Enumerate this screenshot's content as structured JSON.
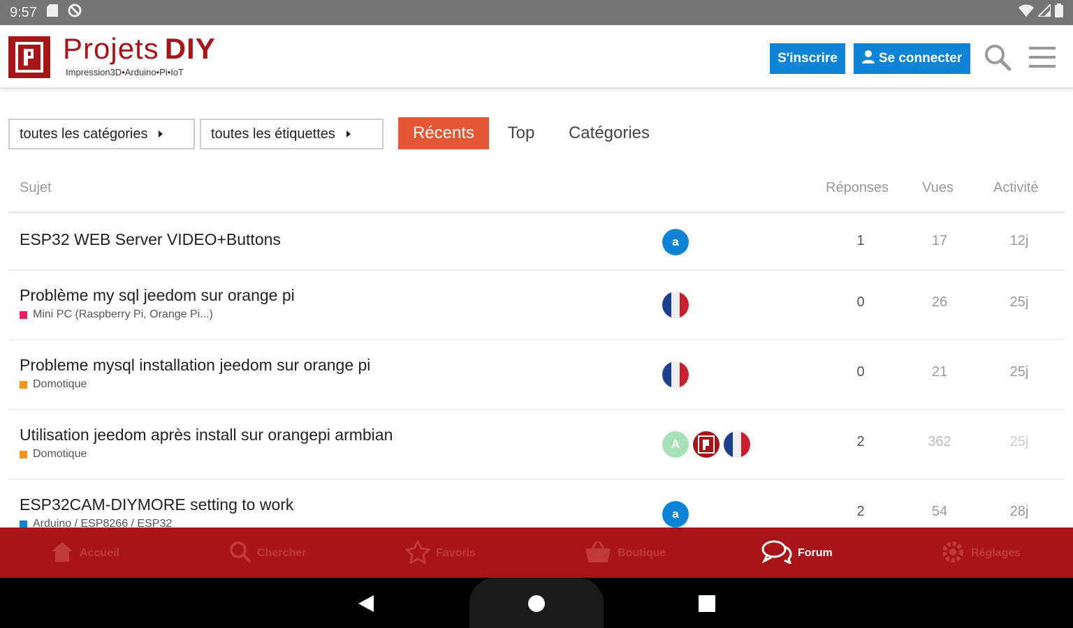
{
  "statusbar": {
    "time": "9:57"
  },
  "header": {
    "logo_title": "Projets",
    "logo_title_accent": "DIY",
    "logo_subtitle": "Impression3D•Arduino•Pi•IoT",
    "signup_label": "S'inscrire",
    "login_label": "Se connecter",
    "brand_color": "#a4161a",
    "button_color": "#0f83d6"
  },
  "filters": {
    "categories_label": "toutes les catégories",
    "tags_label": "toutes les étiquettes",
    "tabs": [
      {
        "label": "Récents",
        "active": true
      },
      {
        "label": "Top",
        "active": false
      },
      {
        "label": "Catégories",
        "active": false
      }
    ],
    "active_color": "#e45735"
  },
  "table": {
    "headers": {
      "subject": "Sujet",
      "replies": "Réponses",
      "views": "Vues",
      "activity": "Activité"
    },
    "rows": [
      {
        "title": "ESP32 WEB Server VIDEO+Buttons",
        "category": "",
        "category_color": "",
        "posters": [
          "a"
        ],
        "replies": "1",
        "views": "17",
        "activity": "12j"
      },
      {
        "title": "Problème my sql jeedom sur orange pi",
        "category": "Mini PC (Raspberry Pi, Orange Pi...)",
        "category_color": "#e91e63",
        "posters": [
          "flag"
        ],
        "replies": "0",
        "views": "26",
        "activity": "25j"
      },
      {
        "title": "Probleme mysql installation jeedom sur orange pi",
        "category": "Domotique",
        "category_color": "#f7941d",
        "posters": [
          "flag"
        ],
        "replies": "0",
        "views": "21",
        "activity": "25j"
      },
      {
        "title": "Utilisation jeedom après install sur orangepi armbian",
        "category": "Domotique",
        "category_color": "#f7941d",
        "posters": [
          "A",
          "logo",
          "flag"
        ],
        "replies": "2",
        "views": "362",
        "activity": "25j"
      },
      {
        "title": "ESP32CAM-DIYMORE setting to work",
        "category": "Arduino / ESP8266 / ESP32",
        "category_color": "#0f83d6",
        "posters": [
          "a"
        ],
        "replies": "2",
        "views": "54",
        "activity": "28j"
      }
    ]
  },
  "bottomnav": {
    "items": [
      {
        "label": "Accueil",
        "icon": "home-icon"
      },
      {
        "label": "Chercher",
        "icon": "search-icon"
      },
      {
        "label": "Favoris",
        "icon": "star-icon"
      },
      {
        "label": "Boutique",
        "icon": "bag-icon"
      },
      {
        "label": "Forum",
        "icon": "forum-icon",
        "active": true
      },
      {
        "label": "Réglages",
        "icon": "gear-icon"
      }
    ],
    "bg_color": "#a8141a"
  }
}
